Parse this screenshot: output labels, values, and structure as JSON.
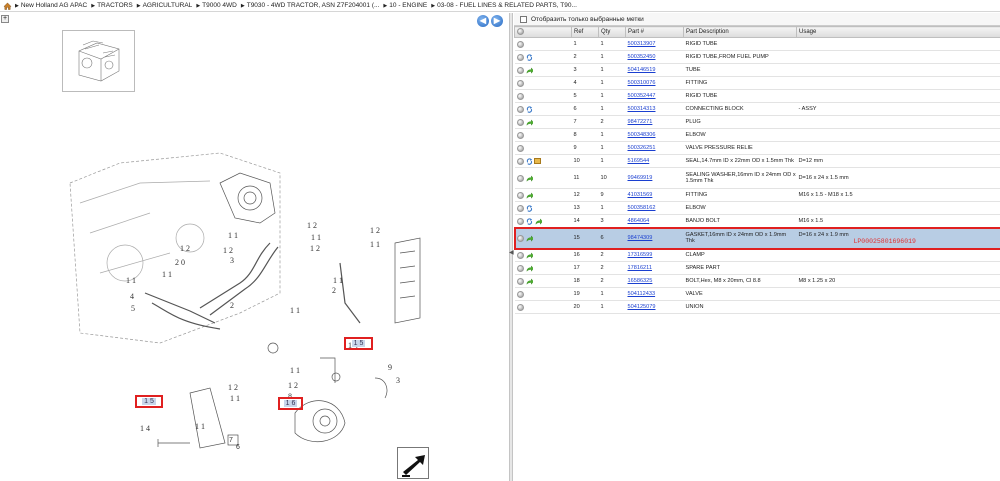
{
  "breadcrumb": [
    "New Holland AG APAC",
    "TRACTORS",
    "AGRICULTURAL",
    "T9000 4WD",
    "T9030 - 4WD TRACTOR, ASN Z7F204001 (...",
    "10 - ENGINE",
    "03-08 - FUEL LINES & RELATED PARTS, T90..."
  ],
  "nav": {
    "back_label": "◀",
    "forward_label": "▶",
    "collapse_label": "+"
  },
  "callouts": [
    "1 5",
    "1 5",
    "1 6"
  ],
  "diagram_tags": [
    "7",
    "6"
  ],
  "filter": {
    "label": "Отобразить только выбранные метки"
  },
  "table": {
    "headers": [
      "Ref",
      "Qty",
      "Part #",
      "Part Description",
      "Usage"
    ],
    "rows": [
      {
        "ref": "1",
        "qty": "1",
        "part": "500313907",
        "desc": "RIGID TUBE",
        "usage": "",
        "icons": [
          "dot"
        ]
      },
      {
        "ref": "2",
        "qty": "1",
        "part": "500352450",
        "desc": "RIGID TUBE,FROM FUEL PUMP",
        "usage": "",
        "icons": [
          "dot",
          "sync"
        ]
      },
      {
        "ref": "3",
        "qty": "1",
        "part": "504146519",
        "desc": "TUBE",
        "usage": "",
        "icons": [
          "dot",
          "share"
        ]
      },
      {
        "ref": "4",
        "qty": "1",
        "part": "500310076",
        "desc": "FITTING",
        "usage": "",
        "icons": [
          "dot"
        ]
      },
      {
        "ref": "5",
        "qty": "1",
        "part": "500352447",
        "desc": "RIGID TUBE",
        "usage": "",
        "icons": [
          "dot"
        ]
      },
      {
        "ref": "6",
        "qty": "1",
        "part": "500314313",
        "desc": "CONNECTING BLOCK",
        "usage": "- ASSY",
        "icons": [
          "dot",
          "sync"
        ]
      },
      {
        "ref": "7",
        "qty": "2",
        "part": "98472271",
        "desc": "PLUG",
        "usage": "",
        "icons": [
          "dot",
          "share"
        ]
      },
      {
        "ref": "8",
        "qty": "1",
        "part": "500348306",
        "desc": "ELBOW",
        "usage": "",
        "icons": [
          "dot"
        ]
      },
      {
        "ref": "9",
        "qty": "1",
        "part": "500326251",
        "desc": "VALVE PRESSURE RELIE",
        "usage": "",
        "icons": [
          "dot"
        ]
      },
      {
        "ref": "10",
        "qty": "1",
        "part": "5169544",
        "desc": "SEAL,14.7mm ID x 22mm OD x 1.5mm Thk",
        "usage": "D=12 mm",
        "icons": [
          "dot",
          "sync",
          "pack"
        ]
      },
      {
        "ref": "11",
        "qty": "10",
        "part": "99469919",
        "desc": "SEALING WASHER,16mm ID x 24mm OD x 1.5mm Thk",
        "usage": "D=16 x 24 x 1.5 mm",
        "icons": [
          "dot",
          "share"
        ],
        "tall": true
      },
      {
        "ref": "12",
        "qty": "9",
        "part": "41031569",
        "desc": "FITTING",
        "usage": "M16 x 1.5 - M18 x 1.5",
        "icons": [
          "dot",
          "share"
        ]
      },
      {
        "ref": "13",
        "qty": "1",
        "part": "500358162",
        "desc": "ELBOW",
        "usage": "",
        "icons": [
          "dot",
          "sync"
        ]
      },
      {
        "ref": "14",
        "qty": "3",
        "part": "4864064",
        "desc": "BANJO BOLT",
        "usage": "M16 x 1.5",
        "icons": [
          "dot",
          "sync",
          "share"
        ]
      },
      {
        "ref": "15",
        "qty": "6",
        "part": "98474309",
        "desc": "GASKET,16mm ID x 24mm OD x 1.9mm Thk",
        "usage": "D=16 x 24 x 1.9 mm",
        "icons": [
          "dot",
          "share"
        ],
        "tall": true,
        "selected": true,
        "watermark": "LP00025801696019"
      },
      {
        "ref": "16",
        "qty": "2",
        "part": "17316599",
        "desc": "CLAMP",
        "usage": "",
        "icons": [
          "dot",
          "share"
        ]
      },
      {
        "ref": "17",
        "qty": "2",
        "part": "17816211",
        "desc": "SPARE PART",
        "usage": "",
        "icons": [
          "dot",
          "share"
        ]
      },
      {
        "ref": "18",
        "qty": "2",
        "part": "16586325",
        "desc": "BOLT,Hex, M8 x 20mm, Cl 8.8",
        "usage": "M8 x 1.25 x 20",
        "icons": [
          "dot",
          "share"
        ]
      },
      {
        "ref": "19",
        "qty": "1",
        "part": "504112433",
        "desc": "VALVE",
        "usage": "",
        "icons": [
          "dot"
        ]
      },
      {
        "ref": "20",
        "qty": "1",
        "part": "504125079",
        "desc": "UNION",
        "usage": "",
        "icons": [
          "dot"
        ]
      }
    ]
  },
  "colors": {
    "link": "#1a3fd0",
    "selected_row": "#b8cde4",
    "highlight": "#e02020"
  }
}
